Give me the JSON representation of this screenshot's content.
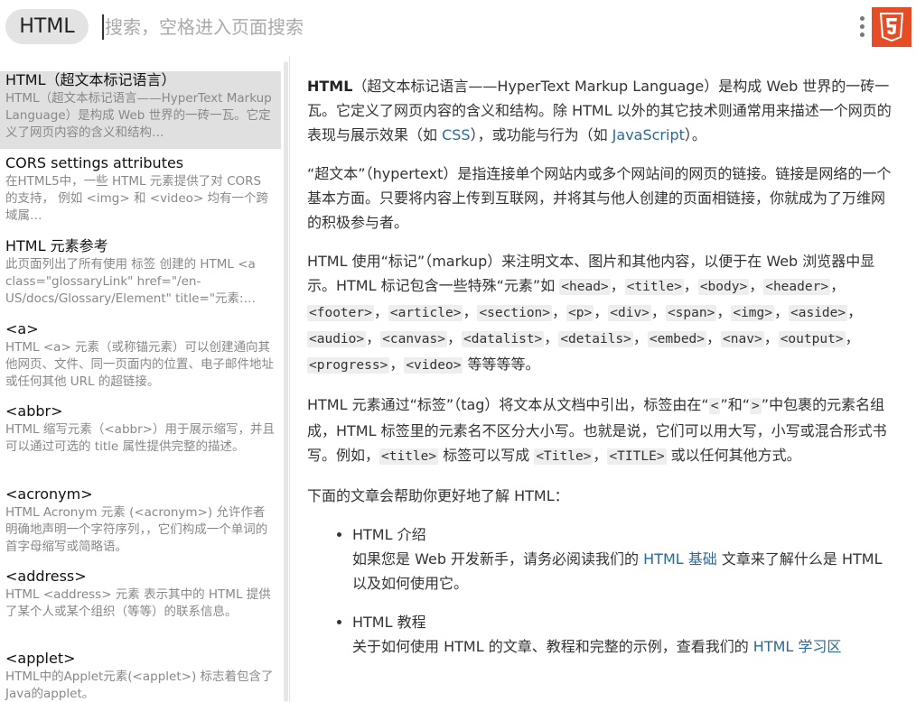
{
  "header": {
    "tag": "HTML",
    "search_placeholder": "搜索，空格进入页面搜索",
    "logo_glyph": "5",
    "accent": "#e44d26"
  },
  "sidebar": {
    "items": [
      {
        "title": "HTML（超文本标记语言）",
        "desc": "HTML（超文本标记语言——HyperText Markup Language）是构成 Web 世界的一砖一瓦。它定义了网页内容的含义和结构…"
      },
      {
        "title": "CORS settings attributes",
        "desc": "在HTML5中，一些 HTML 元素提供了对 CORS 的支持， 例如 <img> 和 <video> 均有一个跨域属…"
      },
      {
        "title": "HTML 元素参考",
        "desc": "此页面列出了所有使用 标签 创建的 HTML <a class=\"glossaryLink\" href=\"/en-US/docs/Glossary/Element\" title=\"元素:…"
      },
      {
        "title": "<a>",
        "desc": "HTML <a> 元素（或称锚元素）可以创建通向其他网页、文件、同一页面内的位置、电子邮件地址或任何其他 URL 的超链接。"
      },
      {
        "title": "<abbr>",
        "desc": "HTML 缩写元素（<abbr>）用于展示缩写，并且可以通过可选的 title 属性提供完整的描述。"
      },
      {
        "title": "<acronym>",
        "desc": "HTML Acronym 元素 (<acronym>) 允许作者明确地声明一个字符序列，，它们构成一个单词的首字母缩写或简略语。"
      },
      {
        "title": "<address>",
        "desc": "HTML <address> 元素 表示其中的 HTML 提供了某个人或某个组织（等等）的联系信息。"
      },
      {
        "title": "<applet>",
        "desc": "HTML中的Applet元素(<applet>) 标志着包含了Java的applet。"
      }
    ]
  },
  "article": {
    "p1_bold": "HTML",
    "p1_a": "（超文本标记语言——HyperText Markup Language）是构成 Web 世界的一砖一瓦。它定义了网页内容的含义和结构。除 HTML 以外的其它技术则通常用来描述一个网页的表现与展示效果（如 ",
    "p1_link1": "CSS",
    "p1_b": "），或功能与行为（如 ",
    "p1_link2": "JavaScript",
    "p1_c": "）。",
    "p2": "“超文本”（hypertext）是指连接单个网站内或多个网站间的网页的链接。链接是网络的一个基本方面。只要将内容上传到互联网，并将其与他人创建的页面相链接，你就成为了万维网的积极参与者。",
    "p3_intro": "HTML 使用“标记”（markup）来注明文本、图片和其他内容，以便于在 Web 浏览器中显示。HTML 标记包含一些特殊“元素”如 ",
    "p3_tags": [
      "<head>",
      "<title>",
      "<body>",
      "<header>",
      "<footer>",
      "<article>",
      "<section>",
      "<p>",
      "<div>",
      "<span>",
      "<img>",
      "<aside>",
      "<audio>",
      "<canvas>",
      "<datalist>",
      "<details>",
      "<embed>",
      "<nav>",
      "<output>",
      "<progress>",
      "<video>"
    ],
    "p3_sep": "，",
    "p3_end": " 等等等等。",
    "p4_a": "HTML 元素通过“标签”（tag）将文本从文档中引出，标签由在“",
    "p4_lt": "<",
    "p4_b": "”和“",
    "p4_gt": ">",
    "p4_c": "”中包裹的元素名组成，HTML 标签里的元素名不区分大小写。也就是说，它们可以用大写，小写或混合形式书写。例如，",
    "p4_code1": "<title>",
    "p4_d": " 标签可以写成 ",
    "p4_code2": "<Title>",
    "p4_e": "，",
    "p4_code3": "<TITLE>",
    "p4_f": " 或以任何其他方式。",
    "p5": "下面的文章会帮助你更好地了解 HTML：",
    "li1_title": "HTML 介绍",
    "li1_a": "如果您是 Web 开发新手，请务必阅读我们的 ",
    "li1_link": "HTML 基础",
    "li1_b": " 文章来了解什么是 HTML 以及如何使用它。",
    "li2_title": "HTML 教程",
    "li2_a": "关于如何使用 HTML 的文章、教程和完整的示例，查看我们的 ",
    "li2_link": "HTML 学习区"
  }
}
